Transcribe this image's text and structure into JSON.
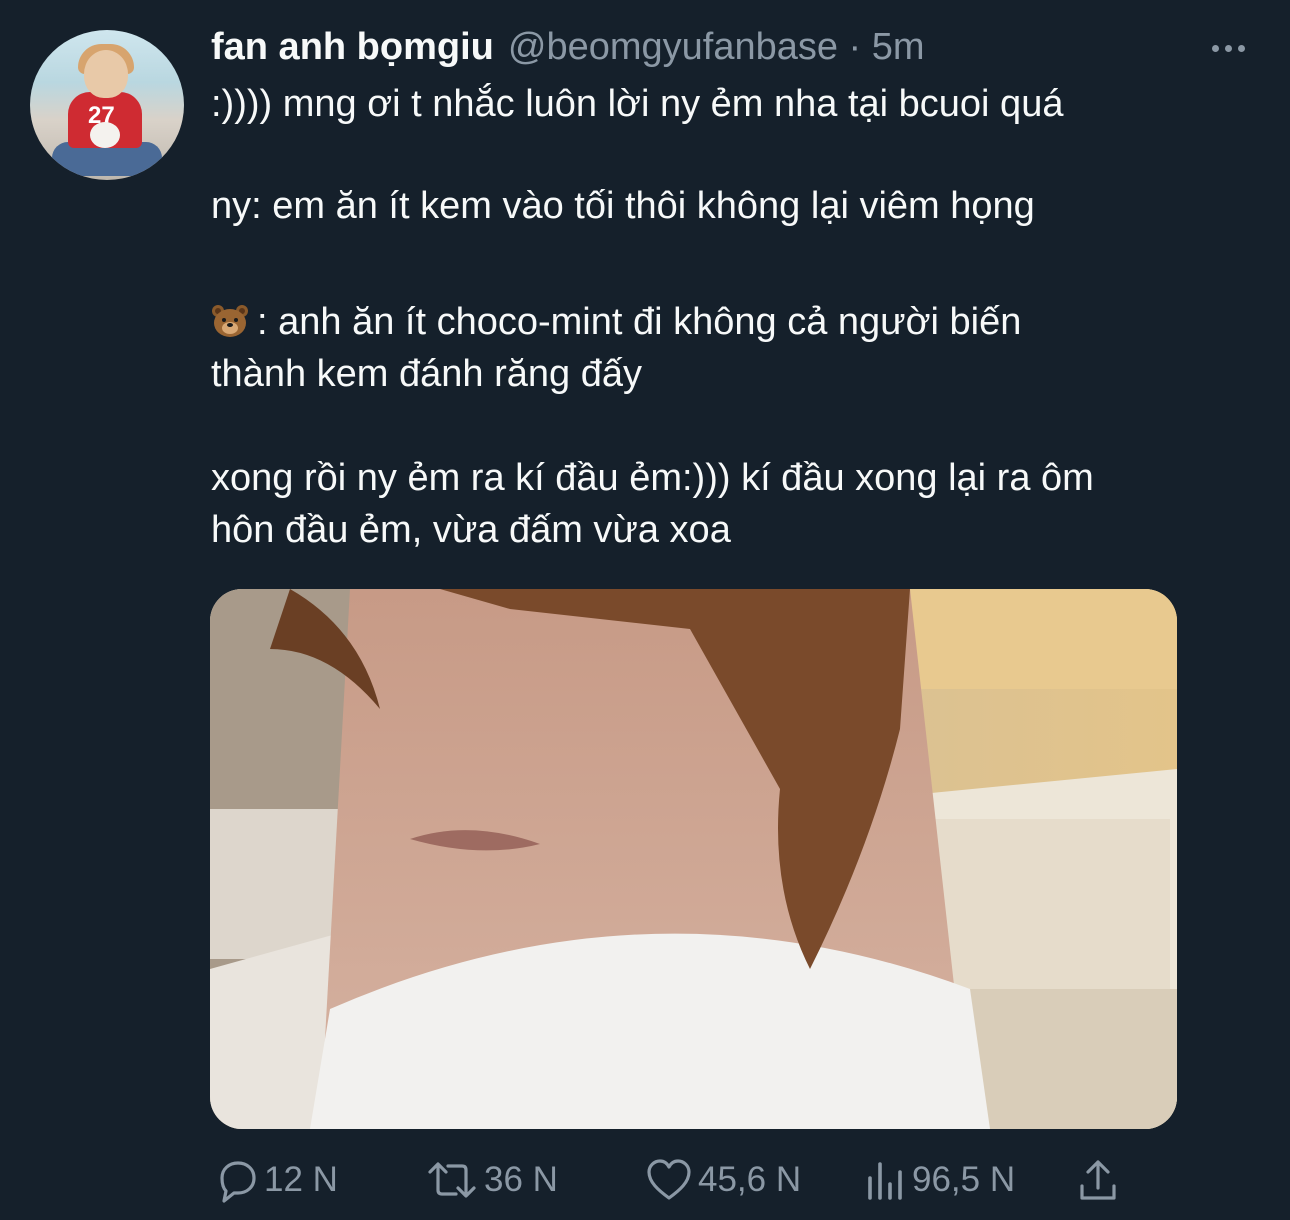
{
  "tweet": {
    "display_name": "fan anh bọmgiu",
    "handle_time": "@beomgyufanbase · 5m",
    "text_lines": [
      ":)))) mng ơi t nhắc luôn lời ny ẻm nha tại bcuoi quá",
      "ny: em ăn ít kem vào tối thôi không lại viêm họng",
      ": anh ăn ít choco-mint đi không cả người biến",
      "thành kem đánh răng đấy",
      "xong rồi ny ẻm ra kí đầu ẻm:))) kí đầu xong lại ra ôm",
      "hôn đầu ẻm, vừa đấm vừa xoa"
    ],
    "emoji": "bear-face-emoji"
  },
  "actions": {
    "reply_count": "12 N",
    "retweet_count": "36 N",
    "like_count": "45,6 N",
    "views_count": "96,5 N"
  },
  "icons": [
    "more-icon",
    "reply-icon",
    "retweet-icon",
    "like-icon",
    "views-icon",
    "share-icon"
  ],
  "colors": {
    "background": "#15202b",
    "text": "#f7f9f9",
    "secondary": "#8b98a5"
  }
}
